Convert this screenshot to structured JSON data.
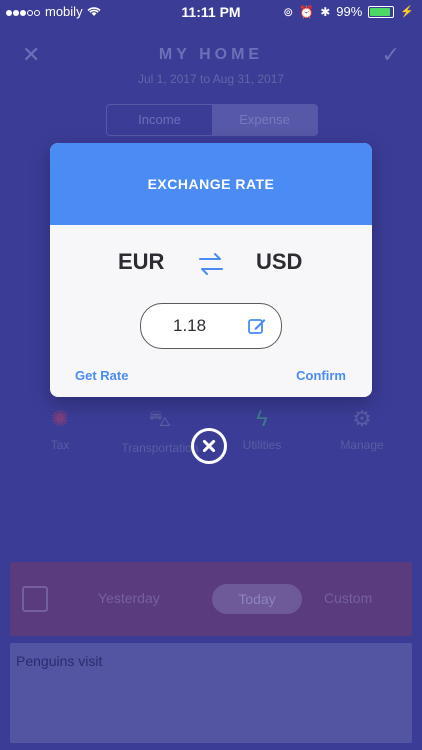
{
  "status": {
    "carrier": "mobily",
    "time": "11:11 PM",
    "battery": "99%"
  },
  "header": {
    "title": "MY HOME",
    "date_range": "Jul 1, 2017 to Aug 31, 2017",
    "close_icon": "x-icon",
    "confirm_icon": "checkmark-icon"
  },
  "segment": {
    "income": "Income",
    "expense": "Expense",
    "selected": "Expense"
  },
  "categories": [
    {
      "label": "Tax",
      "icon": "tax-icon"
    },
    {
      "label": "Transportation",
      "icon": "car-icon"
    },
    {
      "label": "Utilities",
      "icon": "lightning-icon"
    },
    {
      "label": "Manage",
      "icon": "gear-icon"
    }
  ],
  "date": {
    "yesterday": "Yesterday",
    "today": "Today",
    "custom": "Custom"
  },
  "note": {
    "text": "Penguins visit"
  },
  "modal": {
    "title": "EXCHANGE RATE",
    "from": "EUR",
    "to": "USD",
    "rate": "1.18",
    "get_rate": "Get Rate",
    "confirm": "Confirm"
  },
  "colors": {
    "accent": "#4a8cf4",
    "overlay": "#3b3c96"
  }
}
